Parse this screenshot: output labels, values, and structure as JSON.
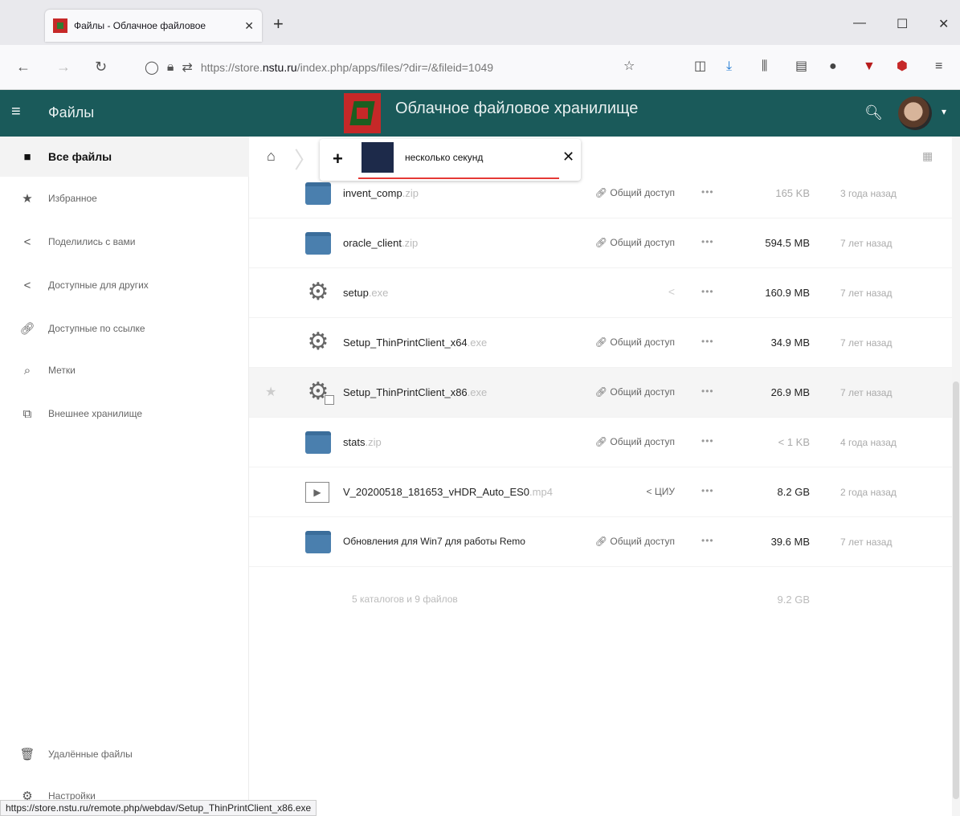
{
  "browser": {
    "tab_title": "Файлы - Облачное файловое",
    "tab_close": "✕",
    "new_tab": "+",
    "url_prefix": "https://store.",
    "url_domain": "nstu.ru",
    "url_path": "/index.php/apps/files/?dir=/&fileid=1049",
    "status_url": "https://store.nstu.ru/remote.php/webdav/Setup_ThinPrintClient_x86.exe"
  },
  "header": {
    "app_name": "Файлы",
    "title": "Облачное файловое хранилище"
  },
  "sidebar": {
    "items": [
      {
        "label": "Все файлы"
      },
      {
        "label": "Избранное"
      },
      {
        "label": "Поделились с вами"
      },
      {
        "label": "Доступные для других"
      },
      {
        "label": "Доступные по ссылке"
      },
      {
        "label": "Метки"
      },
      {
        "label": "Внешнее хранилище"
      }
    ],
    "deleted": "Удалённые файлы",
    "settings": "Настройки"
  },
  "upload": {
    "status": "несколько секунд",
    "plus": "+",
    "close": "✕"
  },
  "files": [
    {
      "name": "invent_comp",
      "ext": ".zip",
      "share": "Общий доступ",
      "size": "165 KB",
      "date": "3 года назад",
      "type": "folder"
    },
    {
      "name": "oracle_client",
      "ext": ".zip",
      "share": "Общий доступ",
      "size": "594.5 MB",
      "date": "7 лет назад",
      "type": "folder"
    },
    {
      "name": "setup",
      "ext": ".exe",
      "share": "",
      "size": "160.9 MB",
      "date": "7 лет назад",
      "type": "gear"
    },
    {
      "name": "Setup_ThinPrintClient_x64",
      "ext": ".exe",
      "share": "Общий доступ",
      "size": "34.9 MB",
      "date": "7 лет назад",
      "type": "gear"
    },
    {
      "name": "Setup_ThinPrintClient_x86",
      "ext": ".exe",
      "share": "Общий доступ",
      "size": "26.9 MB",
      "date": "7 лет назад",
      "type": "gear"
    },
    {
      "name": "stats",
      "ext": ".zip",
      "share": "Общий доступ",
      "size": "< 1 KB",
      "date": "4 года назад",
      "type": "folder"
    },
    {
      "name": "V_20200518_181653_vHDR_Auto_ES0",
      "ext": ".mp4",
      "share": "ЦИУ",
      "size": "8.2 GB",
      "date": "2 года назад",
      "type": "video"
    },
    {
      "name": "Обновления для Win7 для работы Remo",
      "ext": "",
      "share": "Общий доступ",
      "size": "39.6 MB",
      "date": "7 лет назад",
      "type": "folder"
    }
  ],
  "summary": {
    "text": "5 каталогов и 9 файлов",
    "size": "9.2 GB"
  },
  "colors": {
    "header_bg": "#1a5a5a",
    "folder": "#4a7fae",
    "progress": "#e53935"
  }
}
